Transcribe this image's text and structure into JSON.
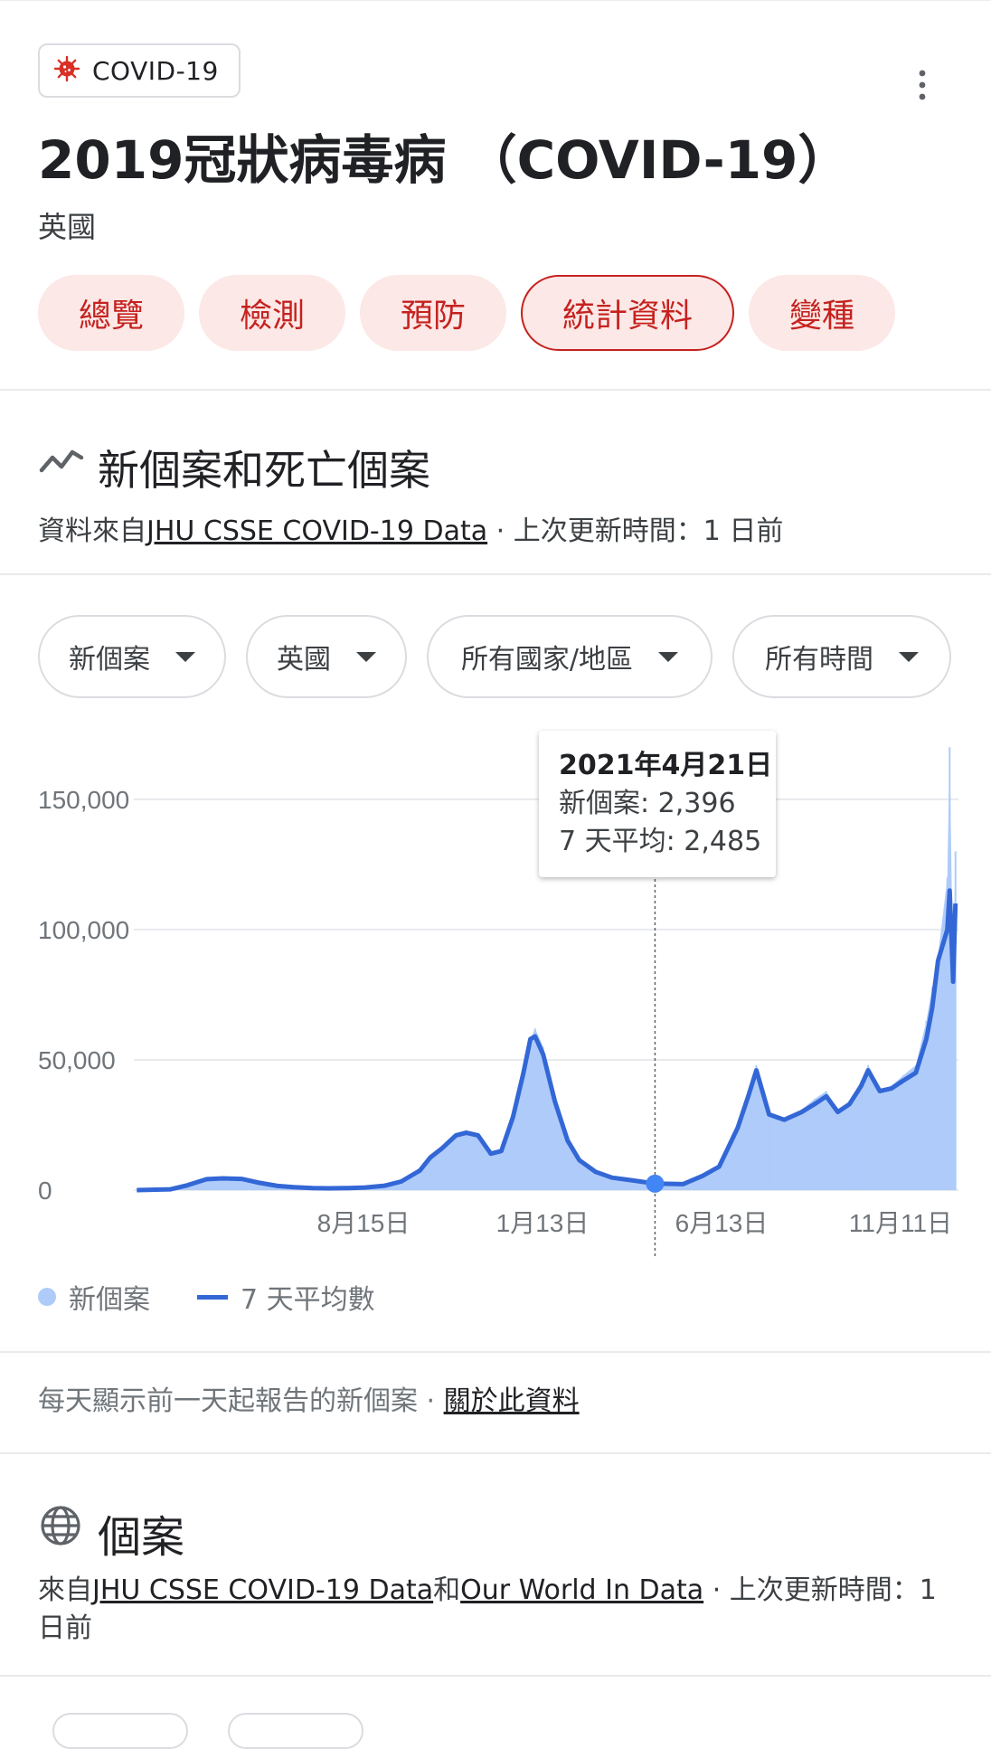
{
  "header": {
    "chip_label": "COVID-19",
    "chip_icon": "virus-icon",
    "title": "2019冠狀病毒病 （COVID-19）",
    "location": "英國",
    "more_icon": "more-vert-icon"
  },
  "tabs": [
    {
      "label": "總覽",
      "active": false
    },
    {
      "label": "檢測",
      "active": false
    },
    {
      "label": "預防",
      "active": false
    },
    {
      "label": "統計資料",
      "active": true
    },
    {
      "label": "變種",
      "active": false
    }
  ],
  "section": {
    "title": "新個案和死亡個案",
    "icon": "trend-line-icon",
    "source_prefix": "資料來自",
    "source_link": "JHU CSSE COVID-19 Data",
    "source_suffix": " · 上次更新時間：1 日前"
  },
  "filters": [
    {
      "label": "新個案"
    },
    {
      "label": "英國"
    },
    {
      "label": "所有國家/地區"
    },
    {
      "label": "所有時間"
    }
  ],
  "tooltip": {
    "date": "2021年4月21日",
    "new_cases": "新個案: 2,396",
    "avg": "7 天平均: 2,485"
  },
  "legend": {
    "new_cases": "新個案",
    "avg": "7 天平均數"
  },
  "note": {
    "text": "每天顯示前一天起報告的新個案 · ",
    "link": "關於此資料"
  },
  "cases": {
    "title": "個案",
    "icon": "globe-icon",
    "prefix": "來自",
    "link1": "JHU CSSE COVID-19 Data",
    "mid": "和",
    "link2": "Our World In Data",
    "suffix": " · 上次更新時間：1 日前"
  },
  "colors": {
    "accent_red": "#c5221f",
    "tab_bg": "#fce8e6",
    "bar_fill": "#aecbfa",
    "line": "#3367d6"
  },
  "chart_data": {
    "type": "area",
    "title": "",
    "xlabel": "",
    "ylabel": "",
    "ylim": [
      0,
      160000
    ],
    "yticks": [
      0,
      50000,
      100000,
      150000
    ],
    "ytick_labels": [
      "0",
      "50,000",
      "100,000",
      "150,000"
    ],
    "xticks": [
      "8月15日",
      "1月13日",
      "6月13日",
      "11月11日"
    ],
    "grid": true,
    "highlight": {
      "date": "2021年4月21日",
      "new_cases": 2396,
      "avg_7d": 2485
    },
    "series": [
      {
        "name": "新個案",
        "x": [
          "2020-02-01",
          "2020-03-01",
          "2020-03-15",
          "2020-04-01",
          "2020-04-15",
          "2020-05-01",
          "2020-05-15",
          "2020-06-01",
          "2020-06-15",
          "2020-07-01",
          "2020-07-15",
          "2020-08-01",
          "2020-08-15",
          "2020-09-01",
          "2020-09-15",
          "2020-10-01",
          "2020-10-10",
          "2020-10-20",
          "2020-11-01",
          "2020-11-10",
          "2020-11-20",
          "2020-12-01",
          "2020-12-10",
          "2020-12-20",
          "2020-12-29",
          "2021-01-04",
          "2021-01-08",
          "2021-01-15",
          "2021-01-25",
          "2021-02-05",
          "2021-02-15",
          "2021-03-01",
          "2021-03-15",
          "2021-04-01",
          "2021-04-21",
          "2021-05-15",
          "2021-06-01",
          "2021-06-15",
          "2021-07-01",
          "2021-07-10",
          "2021-07-17",
          "2021-07-28",
          "2021-08-10",
          "2021-08-25",
          "2021-09-05",
          "2021-09-15",
          "2021-09-25",
          "2021-10-05",
          "2021-10-15",
          "2021-10-21",
          "2021-10-31",
          "2021-11-10",
          "2021-11-20",
          "2021-12-01",
          "2021-12-10",
          "2021-12-15",
          "2021-12-20",
          "2021-12-28",
          "2021-12-30",
          "2022-01-02",
          "2022-01-04"
        ],
        "values": [
          0,
          200,
          2000,
          4500,
          4700,
          4500,
          3000,
          1600,
          1200,
          800,
          700,
          900,
          1100,
          1800,
          3500,
          8000,
          13000,
          16000,
          22000,
          23000,
          20000,
          14000,
          16000,
          30000,
          48000,
          58000,
          62000,
          55000,
          35000,
          20000,
          12000,
          7000,
          5000,
          4000,
          2396,
          2500,
          6000,
          10000,
          25000,
          38000,
          48000,
          28000,
          27000,
          31000,
          35000,
          38000,
          31000,
          34000,
          42000,
          48000,
          38000,
          40000,
          44000,
          48000,
          65000,
          78000,
          90000,
          120000,
          170000,
          80000,
          130000
        ]
      },
      {
        "name": "7 天平均數",
        "x": [
          "2020-02-01",
          "2020-03-01",
          "2020-03-15",
          "2020-04-01",
          "2020-04-15",
          "2020-05-01",
          "2020-05-15",
          "2020-06-01",
          "2020-06-15",
          "2020-07-01",
          "2020-07-15",
          "2020-08-01",
          "2020-08-15",
          "2020-09-01",
          "2020-09-15",
          "2020-10-01",
          "2020-10-10",
          "2020-10-20",
          "2020-11-01",
          "2020-11-10",
          "2020-11-20",
          "2020-12-01",
          "2020-12-10",
          "2020-12-20",
          "2020-12-29",
          "2021-01-04",
          "2021-01-08",
          "2021-01-15",
          "2021-01-25",
          "2021-02-05",
          "2021-02-15",
          "2021-03-01",
          "2021-03-15",
          "2021-04-01",
          "2021-04-21",
          "2021-05-15",
          "2021-06-01",
          "2021-06-15",
          "2021-07-01",
          "2021-07-10",
          "2021-07-17",
          "2021-07-28",
          "2021-08-10",
          "2021-08-25",
          "2021-09-05",
          "2021-09-15",
          "2021-09-25",
          "2021-10-05",
          "2021-10-15",
          "2021-10-21",
          "2021-10-31",
          "2021-11-10",
          "2021-11-20",
          "2021-12-01",
          "2021-12-10",
          "2021-12-15",
          "2021-12-20",
          "2021-12-28",
          "2021-12-30",
          "2022-01-02",
          "2022-01-04"
        ],
        "values": [
          0,
          300,
          1800,
          4200,
          4500,
          4300,
          2900,
          1600,
          1100,
          800,
          700,
          800,
          1000,
          1700,
          3300,
          7500,
          12500,
          16000,
          21000,
          22000,
          21000,
          14000,
          15000,
          28000,
          45000,
          58000,
          59000,
          52000,
          34000,
          19000,
          11500,
          7000,
          4800,
          3800,
          2485,
          2300,
          5500,
          9000,
          24000,
          36000,
          46000,
          29000,
          27000,
          30000,
          33000,
          36000,
          30000,
          33000,
          40000,
          46000,
          38000,
          39000,
          42000,
          45000,
          58000,
          70000,
          88000,
          100000,
          115000,
          80000,
          110000
        ]
      }
    ]
  }
}
